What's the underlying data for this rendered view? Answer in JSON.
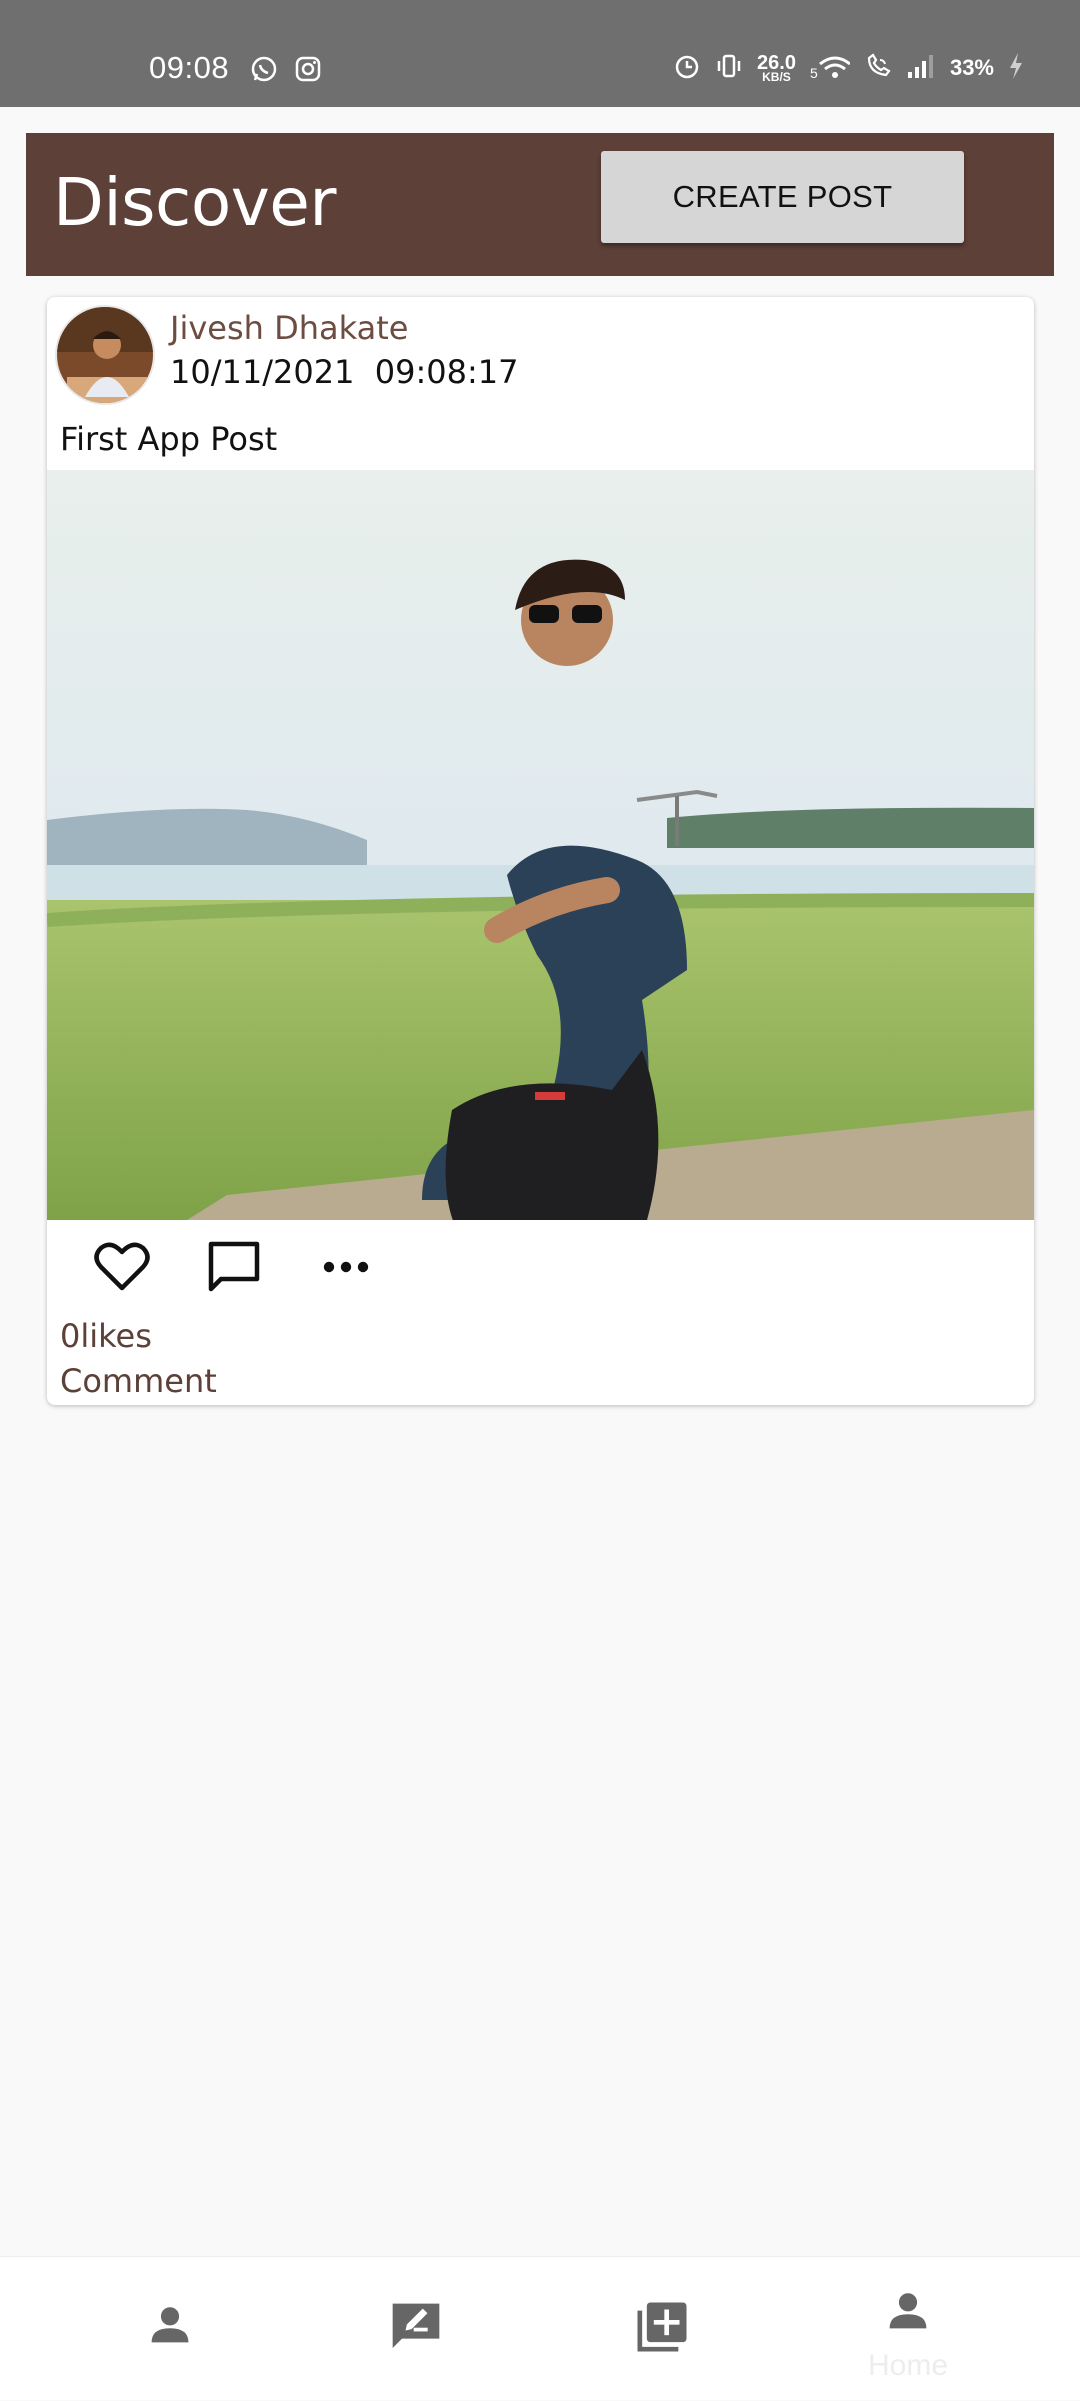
{
  "status_bar": {
    "time": "09:08",
    "net_speed_value": "26.0",
    "net_speed_unit": "KB/S",
    "battery": "33%",
    "icons": [
      "whatsapp-icon",
      "instagram-icon",
      "alarm-icon",
      "vibrate-icon",
      "wifi-icon",
      "wifi-calling-icon",
      "signal-icon",
      "charging-icon"
    ]
  },
  "header": {
    "title": "Discover",
    "create_post_label": "CREATE POST",
    "background": "#5d4037"
  },
  "post": {
    "author": "Jivesh Dhakate",
    "date": "10/11/2021",
    "time": "09:08:17",
    "caption": "First App Post",
    "likes_text": "0likes",
    "comment_label": "Comment",
    "actions": [
      "heart-icon",
      "comment-icon",
      "more-icon"
    ]
  },
  "bottom_nav": {
    "items": [
      {
        "icon": "person-icon"
      },
      {
        "icon": "edit-note-icon"
      },
      {
        "icon": "add-post-icon"
      },
      {
        "icon": "person-icon",
        "label": "Home",
        "selected": true
      }
    ]
  },
  "colors": {
    "accent": "#5d4037",
    "link_brown": "#6d4c41",
    "status_bar": "#6f6f6f"
  }
}
